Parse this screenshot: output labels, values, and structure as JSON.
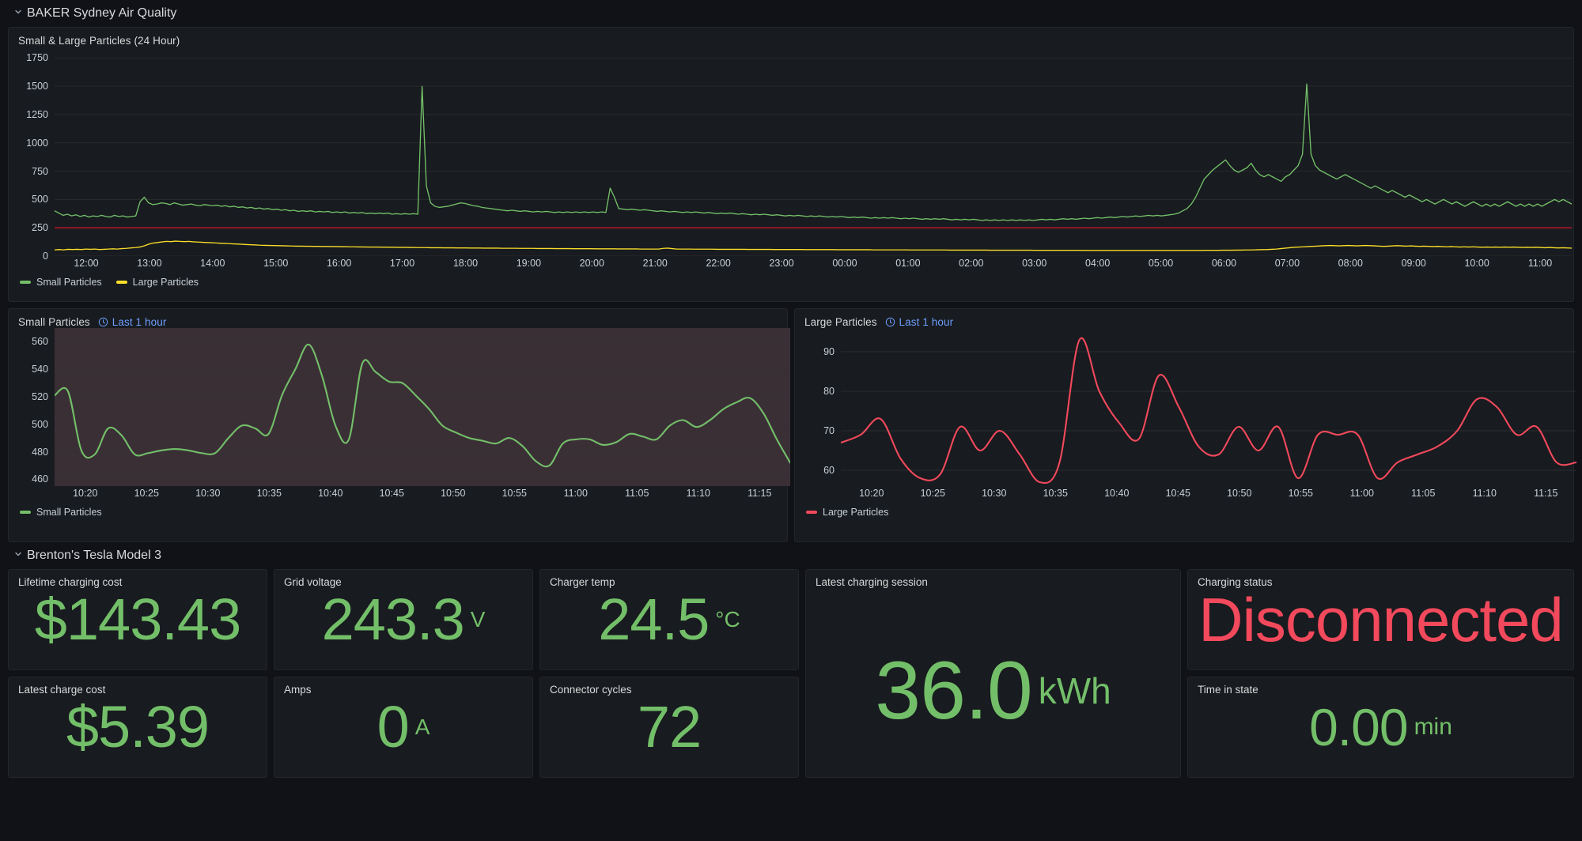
{
  "rows": [
    {
      "title": "BAKER Sydney Air Quality"
    },
    {
      "title": "Brenton's Tesla Model 3"
    }
  ],
  "colors": {
    "green": "#73bf69",
    "yellow": "#fade2a",
    "red": "#f2495c",
    "threshold_red": "#c4162a",
    "blue_link": "#6e9fff",
    "panel_bg": "#181b1f",
    "series_fill": "#3b2f36"
  },
  "main_panel": {
    "title": "Small & Large Particles (24 Hour)",
    "legend": [
      {
        "label": "Small Particles",
        "color": "#73bf69"
      },
      {
        "label": "Large Particles",
        "color": "#fade2a"
      }
    ]
  },
  "small_particles_panel": {
    "title": "Small Particles",
    "time_override": "Last 1 hour",
    "time_icon": "clock-icon",
    "legend": [
      {
        "label": "Small Particles",
        "color": "#73bf69"
      }
    ]
  },
  "large_particles_panel": {
    "title": "Large Particles",
    "time_override": "Last 1 hour",
    "time_icon": "clock-icon",
    "legend": [
      {
        "label": "Large Particles",
        "color": "#f2495c"
      }
    ]
  },
  "stats": [
    {
      "label": "Lifetime charging cost",
      "value": "$143.43",
      "unit": "",
      "color": "#73bf69"
    },
    {
      "label": "Grid voltage",
      "value": "243.3",
      "unit": "V",
      "color": "#73bf69"
    },
    {
      "label": "Charger temp",
      "value": "24.5",
      "unit": "°C",
      "color": "#73bf69"
    },
    {
      "label": "Latest charge cost",
      "value": "$5.39",
      "unit": "",
      "color": "#73bf69"
    },
    {
      "label": "Amps",
      "value": "0",
      "unit": "A",
      "color": "#73bf69"
    },
    {
      "label": "Connector cycles",
      "value": "72",
      "unit": "",
      "color": "#73bf69"
    },
    {
      "label": "Latest charging session",
      "value": "36.0",
      "unit": "kWh",
      "color": "#73bf69"
    },
    {
      "label": "Charging status",
      "value": "Disconnected",
      "unit": "",
      "color": "#f2495c"
    },
    {
      "label": "Time in state",
      "value": "0.00",
      "unit": "min",
      "color": "#73bf69"
    }
  ],
  "chart_data": [
    {
      "id": "main-24h",
      "type": "line",
      "title": "Small & Large Particles (24 Hour)",
      "xlabel": "",
      "ylabel": "",
      "ylim": [
        0,
        1850
      ],
      "yticks": [
        0,
        250,
        500,
        750,
        1000,
        1250,
        1500,
        1750
      ],
      "grid": true,
      "legend_position": "bottom-left",
      "xticks": [
        "12:00",
        "13:00",
        "14:00",
        "15:00",
        "16:00",
        "17:00",
        "18:00",
        "19:00",
        "20:00",
        "21:00",
        "22:00",
        "23:00",
        "00:00",
        "01:00",
        "02:00",
        "03:00",
        "04:00",
        "05:00",
        "06:00",
        "07:00",
        "08:00",
        "09:00",
        "10:00",
        "11:00"
      ],
      "threshold": {
        "value": 250,
        "color": "#c4162a"
      },
      "series": [
        {
          "name": "Small Particles",
          "color": "#73bf69",
          "values": [
            400,
            380,
            360,
            370,
            355,
            365,
            350,
            360,
            345,
            355,
            350,
            360,
            350,
            345,
            360,
            350,
            355,
            345,
            350,
            355,
            480,
            520,
            470,
            455,
            460,
            470,
            465,
            455,
            470,
            460,
            450,
            455,
            460,
            450,
            445,
            455,
            450,
            445,
            450,
            440,
            445,
            435,
            440,
            430,
            435,
            425,
            430,
            420,
            425,
            415,
            420,
            410,
            415,
            405,
            410,
            400,
            405,
            395,
            400,
            395,
            400,
            390,
            395,
            390,
            395,
            385,
            390,
            385,
            390,
            380,
            385,
            380,
            385,
            375,
            380,
            375,
            380,
            375,
            380,
            370,
            375,
            370,
            375,
            370,
            375,
            370,
            1500,
            620,
            470,
            440,
            430,
            435,
            440,
            450,
            460,
            470,
            465,
            455,
            445,
            440,
            430,
            425,
            420,
            415,
            410,
            405,
            400,
            405,
            400,
            395,
            400,
            395,
            390,
            395,
            390,
            395,
            390,
            385,
            390,
            385,
            390,
            385,
            390,
            385,
            390,
            385,
            390,
            385,
            390,
            385,
            600,
            520,
            420,
            415,
            410,
            415,
            410,
            405,
            410,
            405,
            400,
            395,
            400,
            395,
            390,
            395,
            390,
            385,
            390,
            385,
            390,
            385,
            380,
            385,
            380,
            375,
            380,
            375,
            380,
            375,
            370,
            375,
            370,
            365,
            370,
            365,
            370,
            365,
            360,
            365,
            360,
            355,
            360,
            355,
            360,
            355,
            350,
            355,
            350,
            355,
            350,
            345,
            350,
            345,
            350,
            345,
            340,
            345,
            340,
            345,
            340,
            335,
            340,
            335,
            340,
            335,
            340,
            335,
            330,
            335,
            330,
            335,
            330,
            325,
            330,
            325,
            330,
            325,
            330,
            325,
            320,
            325,
            320,
            325,
            320,
            325,
            320,
            315,
            320,
            315,
            320,
            315,
            320,
            315,
            320,
            315,
            320,
            315,
            320,
            315,
            320,
            325,
            320,
            325,
            320,
            325,
            330,
            325,
            330,
            325,
            330,
            335,
            330,
            335,
            340,
            335,
            340,
            345,
            340,
            345,
            350,
            345,
            350,
            355,
            350,
            355,
            360,
            355,
            360,
            355,
            360,
            365,
            370,
            380,
            400,
            420,
            460,
            520,
            600,
            680,
            720,
            760,
            790,
            820,
            850,
            800,
            760,
            740,
            760,
            780,
            820,
            760,
            720,
            700,
            720,
            700,
            680,
            660,
            700,
            720,
            760,
            800,
            900,
            1520,
            900,
            800,
            760,
            740,
            720,
            700,
            680,
            700,
            720,
            700,
            680,
            660,
            640,
            620,
            600,
            620,
            600,
            580,
            560,
            580,
            560,
            540,
            520,
            540,
            520,
            500,
            480,
            500,
            480,
            460,
            480,
            500,
            480,
            460,
            480,
            460,
            440,
            460,
            480,
            460,
            440,
            460,
            440,
            460,
            440,
            460,
            480,
            460,
            440,
            460,
            440,
            460,
            440,
            460,
            440,
            460,
            480,
            500,
            480,
            500,
            480,
            460
          ]
        },
        {
          "name": "Large Particles",
          "color": "#fade2a",
          "values": [
            55,
            58,
            55,
            60,
            58,
            60,
            58,
            62,
            60,
            62,
            58,
            60,
            62,
            64,
            62,
            66,
            68,
            72,
            75,
            80,
            90,
            105,
            115,
            120,
            125,
            130,
            128,
            132,
            130,
            128,
            130,
            126,
            124,
            122,
            120,
            118,
            116,
            114,
            112,
            110,
            108,
            106,
            104,
            102,
            100,
            98,
            96,
            95,
            94,
            93,
            92,
            91,
            90,
            89,
            88,
            88,
            87,
            87,
            86,
            86,
            85,
            85,
            84,
            84,
            83,
            83,
            82,
            82,
            81,
            81,
            80,
            80,
            80,
            79,
            79,
            78,
            78,
            77,
            77,
            76,
            76,
            75,
            75,
            75,
            74,
            74,
            74,
            73,
            73,
            73,
            72,
            72,
            72,
            71,
            71,
            71,
            70,
            70,
            70,
            70,
            69,
            69,
            69,
            69,
            68,
            68,
            68,
            68,
            67,
            67,
            67,
            67,
            66,
            66,
            66,
            66,
            65,
            65,
            65,
            65,
            65,
            64,
            64,
            64,
            64,
            64,
            63,
            63,
            63,
            63,
            63,
            62,
            62,
            62,
            62,
            62,
            68,
            70,
            66,
            62,
            62,
            62,
            62,
            61,
            61,
            61,
            61,
            61,
            60,
            60,
            60,
            60,
            60,
            60,
            60,
            59,
            59,
            59,
            59,
            59,
            59,
            58,
            58,
            58,
            58,
            58,
            58,
            58,
            57,
            57,
            57,
            57,
            57,
            57,
            57,
            56,
            56,
            56,
            56,
            56,
            56,
            56,
            56,
            55,
            55,
            55,
            55,
            55,
            55,
            55,
            55,
            54,
            54,
            54,
            54,
            54,
            54,
            54,
            54,
            54,
            53,
            53,
            53,
            53,
            53,
            53,
            53,
            53,
            53,
            52,
            52,
            52,
            52,
            52,
            52,
            52,
            52,
            52,
            52,
            51,
            51,
            51,
            51,
            51,
            51,
            51,
            51,
            51,
            51,
            51,
            50,
            50,
            50,
            50,
            50,
            50,
            50,
            50,
            50,
            50,
            50,
            50,
            50,
            50,
            50,
            50,
            50,
            50,
            50,
            50,
            50,
            50,
            50,
            50,
            50,
            50,
            50,
            51,
            51,
            51,
            51,
            52,
            52,
            52,
            53,
            53,
            54,
            54,
            55,
            56,
            57,
            58,
            60,
            62,
            66,
            70,
            74,
            78,
            80,
            82,
            84,
            86,
            88,
            90,
            92,
            94,
            92,
            90,
            92,
            94,
            92,
            90,
            92,
            94,
            92,
            90,
            88,
            86,
            88,
            90,
            92,
            90,
            88,
            90,
            88,
            86,
            88,
            86,
            84,
            86,
            84,
            82,
            84,
            82,
            80,
            82,
            80,
            82,
            80,
            78,
            80,
            78,
            80,
            78,
            80,
            78,
            80,
            78,
            76,
            78,
            76,
            78,
            76,
            74,
            76,
            74,
            72,
            74,
            72,
            70
          ]
        }
      ]
    },
    {
      "id": "small-particles-1h",
      "type": "line",
      "title": "Small Particles",
      "xlabel": "",
      "ylabel": "",
      "ylim": [
        455,
        570
      ],
      "yticks": [
        460,
        480,
        500,
        520,
        540,
        560
      ],
      "grid": true,
      "legend_position": "bottom-left",
      "filled": true,
      "xticks": [
        "10:20",
        "10:25",
        "10:30",
        "10:35",
        "10:40",
        "10:45",
        "10:50",
        "10:55",
        "11:00",
        "11:05",
        "11:10",
        "11:15"
      ],
      "series": [
        {
          "name": "Small Particles",
          "color": "#73bf69",
          "values": [
            521,
            524,
            481,
            478,
            497,
            492,
            478,
            479,
            481,
            482,
            481,
            479,
            479,
            490,
            499,
            497,
            493,
            521,
            540,
            558,
            535,
            499,
            489,
            544,
            538,
            531,
            530,
            521,
            511,
            499,
            494,
            490,
            488,
            486,
            490,
            484,
            473,
            470,
            486,
            489,
            489,
            485,
            487,
            493,
            491,
            489,
            499,
            503,
            498,
            503,
            511,
            516,
            519,
            508,
            489,
            472
          ]
        }
      ]
    },
    {
      "id": "large-particles-1h",
      "type": "line",
      "title": "Large Particles",
      "xlabel": "",
      "ylabel": "",
      "ylim": [
        56,
        96
      ],
      "yticks": [
        60,
        70,
        80,
        90
      ],
      "grid": true,
      "legend_position": "bottom-left",
      "xticks": [
        "10:20",
        "10:25",
        "10:30",
        "10:35",
        "10:40",
        "10:45",
        "10:50",
        "10:55",
        "11:00",
        "11:05",
        "11:10",
        "11:15"
      ],
      "series": [
        {
          "name": "Large Particles",
          "color": "#f2495c",
          "values": [
            67,
            69,
            73,
            63,
            58,
            59,
            71,
            65,
            70,
            64,
            57,
            62,
            93,
            80,
            72,
            68,
            84,
            76,
            66,
            64,
            71,
            65,
            71,
            58,
            69,
            69,
            69,
            58,
            62,
            64,
            66,
            70,
            78,
            76,
            69,
            71,
            62,
            62
          ]
        }
      ]
    }
  ]
}
